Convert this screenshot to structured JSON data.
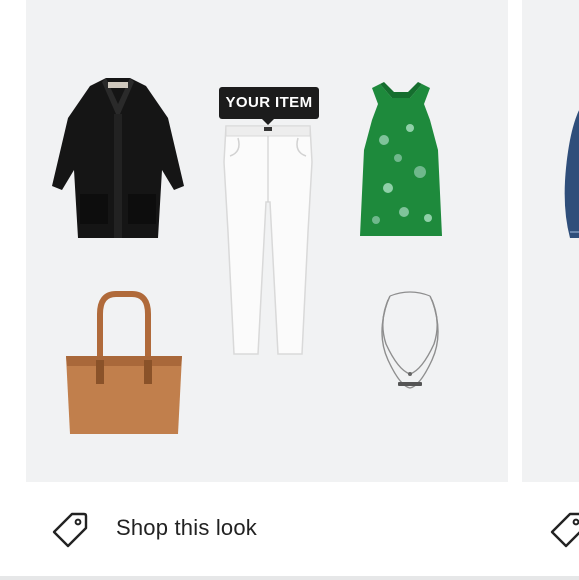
{
  "look_card": {
    "badge_label": "YOUR ITEM",
    "shop_label": "Shop this look",
    "items": [
      {
        "name": "black-cardigan"
      },
      {
        "name": "white-skinny-jeans"
      },
      {
        "name": "green-halter-top"
      },
      {
        "name": "tan-tote-bag"
      },
      {
        "name": "layered-silver-necklace"
      }
    ]
  },
  "colors": {
    "card_background": "#f1f2f3",
    "badge_background": "#1c1c1c",
    "text": "#222222"
  },
  "icons": {
    "shop_tag": "price-tag-icon"
  }
}
